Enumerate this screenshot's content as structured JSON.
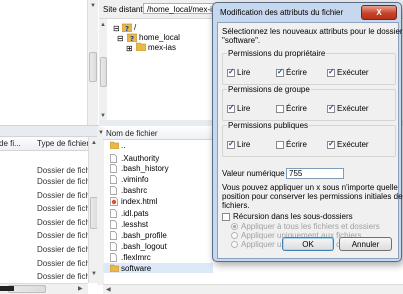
{
  "local": {
    "header": {
      "col1": "de fi...",
      "col2": "Type de fichier"
    },
    "rows": [
      "Dossier de fich.",
      "Dossier de fich.",
      "Dossier de fich.",
      "Dossier de fich.",
      "Dossier de fich.",
      "Dossier de fich.",
      "Dossier de fich.",
      "Dossier de fich.",
      "Dossier de fich."
    ]
  },
  "remote": {
    "site_label": "Site distant :",
    "path": "/home_local/mex-ias",
    "tree": [
      {
        "label": "/"
      },
      {
        "label": "home_local"
      },
      {
        "label": "mex-ias"
      }
    ],
    "list_header": "Nom de fichier",
    "files": [
      {
        "name": "..",
        "type": "folder"
      },
      {
        "name": ".Xauthority",
        "type": "file"
      },
      {
        "name": ".bash_history",
        "type": "file"
      },
      {
        "name": ".viminfo",
        "type": "file"
      },
      {
        "name": ".bashrc",
        "type": "file"
      },
      {
        "name": "index.html",
        "type": "html"
      },
      {
        "name": ".idl.pats",
        "type": "file"
      },
      {
        "name": ".lesshst",
        "type": "file"
      },
      {
        "name": ".bash_profile",
        "type": "file"
      },
      {
        "name": ".bash_logout",
        "type": "file"
      },
      {
        "name": ".flexlmrc",
        "type": "file"
      },
      {
        "name": "software",
        "type": "folder"
      }
    ]
  },
  "dialog": {
    "title": "Modification des attributs du fichier",
    "close_label": "X",
    "intro_line1": "Sélectionnez les nouveaux attributs pour le dossier",
    "intro_line2": "\"software\".",
    "groups": [
      {
        "label": "Permissions du propriétaire",
        "read": "Lire",
        "write": "Écrire",
        "exec": "Exécuter",
        "read_checked": true,
        "write_checked": true,
        "exec_checked": true
      },
      {
        "label": "Permissions de groupe",
        "read": "Lire",
        "write": "Écrire",
        "exec": "Exécuter",
        "read_checked": true,
        "write_checked": false,
        "exec_checked": true
      },
      {
        "label": "Permissions publiques",
        "read": "Lire",
        "write": "Écrire",
        "exec": "Exécuter",
        "read_checked": true,
        "write_checked": false,
        "exec_checked": true
      }
    ],
    "numeric_label": "Valeur numérique :",
    "numeric_value": "755",
    "help_line1": "Vous pouvez appliquer un x sous n'importe quelle",
    "help_line2": "position pour conserver les permissions initiales des",
    "help_line3": "fichiers.",
    "recurse_label": "Récursion dans les sous-dossiers",
    "radio1": "Appliquer à tous les fichiers et dossiers",
    "radio2": "Appliquer uniquement aux fichiers",
    "radio3": "Appliquer uniquement aux dossiers",
    "ok_label": "OK",
    "cancel_label": "Annuler"
  },
  "colors": {
    "dialog_frame": "#c6d8ee",
    "close_button": "#c7442c",
    "folder": "#e8b84a"
  },
  "icons": [
    "folder-icon",
    "file-icon",
    "html-file-icon",
    "close-icon",
    "question-folder-icon"
  ]
}
